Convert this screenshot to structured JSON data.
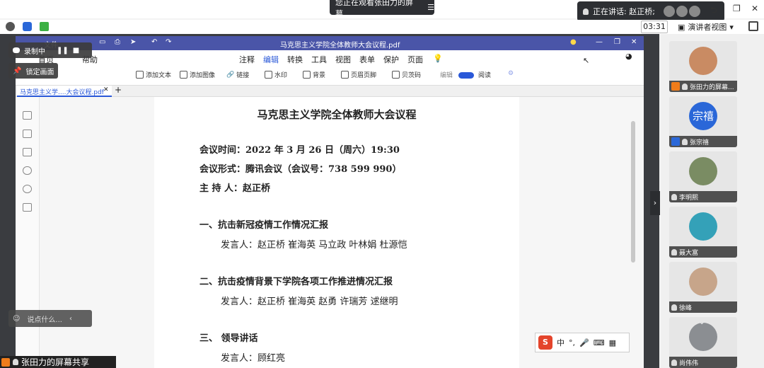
{
  "topbar": {
    "viewing_text": "您正在观看张田力的屏幕",
    "speaking_label": "正在讲话: 赵正桥;"
  },
  "toolbar": {
    "time": "03:31",
    "view_mode": "演讲者视图"
  },
  "recording": {
    "label": "录制中",
    "lock_label": "锁定画面"
  },
  "pdf": {
    "window_title": "马克思主义学院全体教师大会议程.pdf",
    "menu": [
      "注释",
      "编辑",
      "转换",
      "工具",
      "视图",
      "表单",
      "保护",
      "页面"
    ],
    "menu_active": "编辑",
    "left_menu": [
      "文件",
      "首页",
      "帮助"
    ],
    "toolbar": [
      "添加文本",
      "添加图像",
      "链接",
      "水印",
      "背景",
      "页眉页脚",
      "贝茨码",
      "编辑",
      "阅读"
    ],
    "tab_label": "马克思主义学....大会议程.pdf"
  },
  "doc": {
    "title": "马克思主义学院全体教师大会议程",
    "time_line": "会议时间：2022 年 3 月 26 日（周六）19:30",
    "format_line": "会议形式：腾讯会议（会议号：738 599 990）",
    "host_line": "主 持 人：赵正桥",
    "sec1_title": "一、抗击新冠疫情工作情况汇报",
    "sec1_speakers": "发言人：赵正桥 崔海英 马立政 叶林娟 杜源恺",
    "sec2_title": "二、抗击疫情背景下学院各项工作推进情况汇报",
    "sec2_speakers": "发言人：赵正桥 崔海英 赵勇 许瑞芳 逑继明",
    "sec3_title": "三、 领导讲话",
    "sec3_speakers": "发言人：顾红亮"
  },
  "chat": {
    "placeholder": "说点什么..."
  },
  "share_label": "张田力的屏幕共享",
  "ime": {
    "logo": "S",
    "mode": "中"
  },
  "participants": [
    {
      "name": "张田力的屏幕...",
      "avatar_text": ""
    },
    {
      "name": "张宗禧",
      "avatar_text": "宗禧"
    },
    {
      "name": "李明熙",
      "avatar_text": ""
    },
    {
      "name": "聂大富",
      "avatar_text": ""
    },
    {
      "name": "徐峰",
      "avatar_text": ""
    },
    {
      "name": "尚伟伟",
      "avatar_text": ""
    }
  ],
  "colors": {
    "pdf_title_bar": "#4a55a8",
    "accent": "#2a58d8",
    "avatar_blue": "#2a67d8",
    "badge_orange": "#f07c1a"
  }
}
